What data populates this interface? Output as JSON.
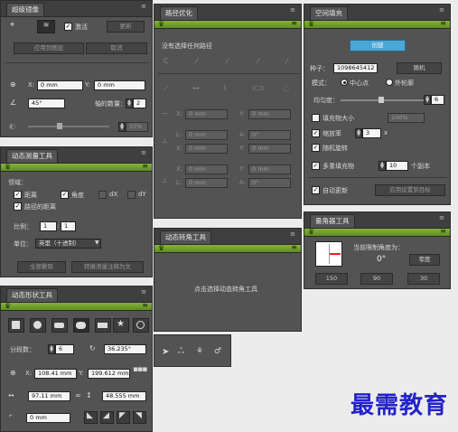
{
  "panels": {
    "mirror": {
      "title": "超级镜像",
      "activate_label": "激活",
      "update_button": "更新",
      "apply_button": "应用到图层",
      "cancel_button": "取消",
      "x_label": "X:",
      "x_value": "0 mm",
      "y_label": "Y:",
      "y_value": "0 mm",
      "angle_value": "45°",
      "axis_count_label": "轴的数量：",
      "axis_count_value": "2",
      "percent_value": "37%"
    },
    "path": {
      "title": "路径优化",
      "no_selection": "没有选择任何路径",
      "x_label": "X:",
      "x_value": "0 mm",
      "y_label": "Y:",
      "y_value": "0 mm",
      "l1_label": "L:",
      "l1_value": "0 mm",
      "a1_label": "A:",
      "a1_value": "0°",
      "x2_label": "X:",
      "x2_value": "0 mm",
      "y2_label": "Y:",
      "y2_value": "0 mm",
      "l2_label": "L:",
      "l2_value": "0 mm",
      "a2_label": "A:",
      "a2_value": "0°"
    },
    "measure": {
      "title": "动态测量工具",
      "domain_label": "领域：",
      "distance_label": "距离",
      "angle_label": "角度",
      "dx_label": "dX",
      "dy_label": "dY",
      "path_distance_label": "路径的距离",
      "scale_label": "比例：",
      "scale_a": "1",
      "scale_sep": ":",
      "scale_b": "1",
      "unit_label": "单位：",
      "unit_value": "英里（十进制）",
      "delete_all_button": "全部删除",
      "convert_button": "转换测量注释为文"
    },
    "corner": {
      "title": "动态转角工具",
      "hint": "点击选择动态转角工具"
    },
    "fill": {
      "title": "空间填充",
      "create_button": "创建",
      "seed_label": "种子：",
      "seed_value": "1098645412",
      "random_button": "随机",
      "mode_label": "模式：",
      "mode_center": "中心点",
      "mode_outside": "外轮廓",
      "uniformity_label": "均匀度：",
      "uniformity_value": "6",
      "fill_size_label": "填充物大小",
      "fill_size_value": "100%",
      "scale_label": "缩放率",
      "scale_value": "3",
      "scale_unit": "x",
      "random_rotate_label": "随机旋转",
      "multi_fill_label": "多重填充物",
      "copies_value": "10",
      "copies_unit": "个副本",
      "auto_update_label": "自动更新",
      "apply_target_button": "应用设置到目标"
    },
    "protractor": {
      "title": "量角器工具",
      "current_angle_label": "当前限制角度为：",
      "angle_value": "0°",
      "reset_button": "零度",
      "btn_150": "150",
      "btn_90": "90",
      "btn_30": "30"
    },
    "shape": {
      "title": "动态形状工具",
      "segments_label": "分段数：",
      "segments_value": "6",
      "rotation_value": "36.235°",
      "x_label": "X:",
      "x_value": "108.41 mm",
      "y_label": "Y:",
      "y_value": "199.612 mm",
      "w_value": "97.11 mm",
      "h_value": "48.555 mm",
      "corner_value": "0 mm"
    }
  },
  "watermark": "最需教育",
  "colors": {
    "panel_bg": "#535353",
    "title_bg": "#3f3f3f",
    "accent_green": "#7aa332",
    "accent_blue": "#4aa7d6",
    "watermark": "#2323c8"
  }
}
